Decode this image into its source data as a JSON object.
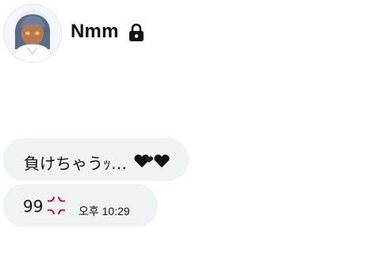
{
  "conversation": {
    "display_name": "Nmm",
    "avatar": "profile-avatar",
    "lock_icon": "lock-icon"
  },
  "messages": [
    {
      "text": "負けちゃうｯ…",
      "emoji": "black-hearts-icon"
    },
    {
      "text": "99",
      "emoji": "anger-symbol-icon",
      "time": "오후 10:29"
    }
  ],
  "colors": {
    "bubble": "#eff3f4",
    "text": "#0f1419",
    "anger": "#c8102e"
  }
}
